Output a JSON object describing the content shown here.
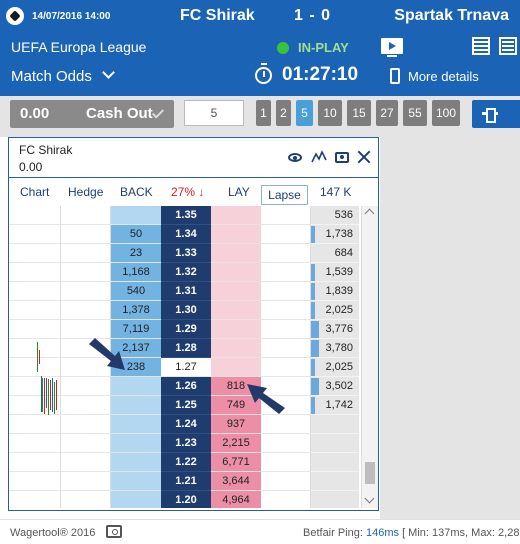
{
  "header": {
    "datetime": "14/07/2016 14:00",
    "home_team": "FC Shirak",
    "score": "1 - 0",
    "away_team": "Spartak Trnava",
    "competition": "UEFA Europa League",
    "status": "IN-PLAY",
    "market": "Match Odds",
    "timer": "01:27:10",
    "more_details": "More details"
  },
  "toolbar": {
    "cashout_amount": "0.00",
    "cashout_label": "Cash Out",
    "stake_value": "5",
    "quick_stakes": [
      "1",
      "2",
      "5",
      "10",
      "15",
      "27",
      "55",
      "100"
    ],
    "selected_stake": "5"
  },
  "selection": {
    "name": "FC Shirak",
    "pl": "0.00"
  },
  "columns": {
    "chart": "Chart",
    "hedge": "Hedge",
    "back": "BACK",
    "percent": "27% ↓",
    "lay": "LAY",
    "lapse": "Lapse",
    "volume_total": "147 K"
  },
  "ladder": [
    {
      "price": "1.35",
      "back": "",
      "lay": "",
      "vol": "536",
      "vol_frac": 0.0
    },
    {
      "price": "1.34",
      "back": "50",
      "lay": "",
      "vol": "1,738",
      "vol_frac": 0.08
    },
    {
      "price": "1.33",
      "back": "23",
      "lay": "",
      "vol": "684",
      "vol_frac": 0.0
    },
    {
      "price": "1.32",
      "back": "1,168",
      "lay": "",
      "vol": "1,539",
      "vol_frac": 0.07
    },
    {
      "price": "1.31",
      "back": "540",
      "lay": "",
      "vol": "1,839",
      "vol_frac": 0.08
    },
    {
      "price": "1.30",
      "back": "1,378",
      "lay": "",
      "vol": "2,025",
      "vol_frac": 0.09
    },
    {
      "price": "1.29",
      "back": "7,119",
      "lay": "",
      "vol": "3,776",
      "vol_frac": 0.17
    },
    {
      "price": "1.28",
      "back": "2,137",
      "lay": "",
      "vol": "3,780",
      "vol_frac": 0.17
    },
    {
      "price": "1.27",
      "back": "238",
      "lay": "",
      "vol": "2,025",
      "vol_frac": 0.09,
      "ltp": true
    },
    {
      "price": "1.26",
      "back": "",
      "lay": "818",
      "vol": "3,502",
      "vol_frac": 0.16
    },
    {
      "price": "1.25",
      "back": "",
      "lay": "749",
      "vol": "1,742",
      "vol_frac": 0.08
    },
    {
      "price": "1.24",
      "back": "",
      "lay": "937",
      "vol": "",
      "vol_frac": 0
    },
    {
      "price": "1.23",
      "back": "",
      "lay": "2,215",
      "vol": "",
      "vol_frac": 0
    },
    {
      "price": "1.22",
      "back": "",
      "lay": "6,771",
      "vol": "",
      "vol_frac": 0
    },
    {
      "price": "1.21",
      "back": "",
      "lay": "3,644",
      "vol": "",
      "vol_frac": 0
    },
    {
      "price": "1.20",
      "back": "",
      "lay": "4,964",
      "vol": "",
      "vol_frac": 0
    }
  ],
  "footer": {
    "brand": "Wagertool® 2016",
    "ping_label": "Betfair Ping: ",
    "ping_value": "146ms",
    "ping_stats": " [ Min: 137ms, Max: 2,28"
  },
  "colors": {
    "header_bg": "#1b63b4",
    "back": "#72b3e2",
    "lay": "#ec8fa6",
    "price": "#1e3d6e"
  }
}
